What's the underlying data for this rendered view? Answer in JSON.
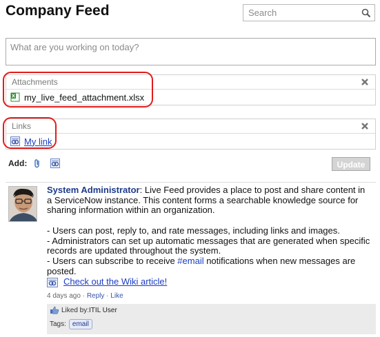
{
  "header": {
    "title": "Company Feed",
    "search_placeholder": "Search"
  },
  "composer": {
    "placeholder": "What are you working on today?"
  },
  "attachments": {
    "heading": "Attachments",
    "file_name": "my_live_feed_attachment.xlsx"
  },
  "links": {
    "heading": "Links",
    "link_text": "My link"
  },
  "add_bar": {
    "label": "Add:",
    "update_label": "Update"
  },
  "post": {
    "author": "System Administrator",
    "intro": ": Live Feed provides a place to post and share content in a ServiceNow instance. This content forms a searchable knowledge source for sharing information within an organization.",
    "bullet1": "- Users can post, reply to, and rate messages, including links and images.",
    "bullet2": "- Administrators can set up automatic messages that are generated when specific records are updated throughout the system.",
    "bullet3_pre": "- Users can subscribe to receive ",
    "bullet3_tag": "#email",
    "bullet3_post": " notifications when new messages are posted.",
    "wiki_link": "Check out the Wiki article!",
    "time": "4 days ago",
    "sep1": " · ",
    "reply": "Reply",
    "sep2": " · ",
    "like": "Like",
    "liked_by_label": "Liked by: ",
    "liked_by_user": "ITIL User",
    "tags_label": "Tags:",
    "tag": "email"
  },
  "colors": {
    "highlight": "#e21b1b",
    "link": "#1a3ec4",
    "excel_green": "#2e8b2e"
  }
}
